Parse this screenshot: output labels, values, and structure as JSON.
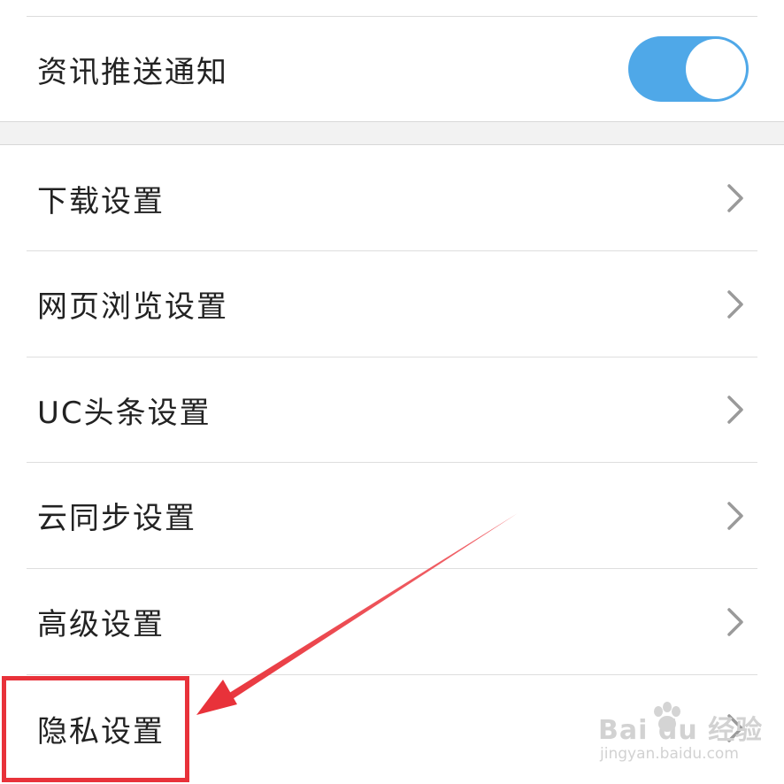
{
  "notification": {
    "label": "资讯推送通知",
    "toggle_state": "on",
    "toggle_color": "#4fa8e8"
  },
  "settings_items": [
    {
      "label": "下载设置",
      "icon": "chevron-right-icon"
    },
    {
      "label": "网页浏览设置",
      "icon": "chevron-right-icon"
    },
    {
      "label": "UC头条设置",
      "icon": "chevron-right-icon"
    },
    {
      "label": "云同步设置",
      "icon": "chevron-right-icon"
    },
    {
      "label": "高级设置",
      "icon": "chevron-right-icon"
    },
    {
      "label": "隐私设置",
      "icon": "chevron-right-icon"
    }
  ],
  "annotation": {
    "highlight_color": "#e8323a",
    "target": "隐私设置"
  },
  "watermark": {
    "brand": "Bai du 经验",
    "url": "jingyan.baidu.com"
  }
}
